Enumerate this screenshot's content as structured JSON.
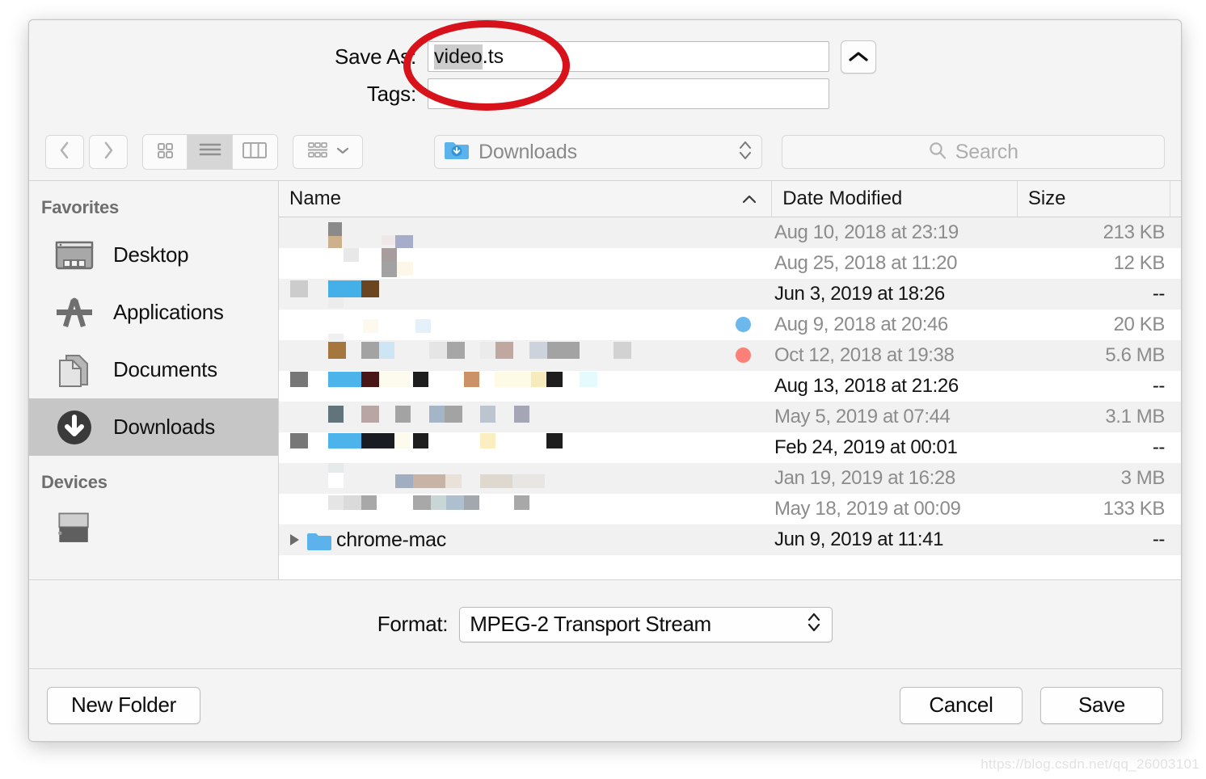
{
  "dialog": {
    "save_as_label": "Save As:",
    "save_as_value_selected": "video",
    "save_as_value_rest": ".ts",
    "tags_label": "Tags:",
    "tags_value": "",
    "tags_placeholder": ""
  },
  "toolbar": {
    "back_icon": "chevron-left-icon",
    "forward_icon": "chevron-right-icon",
    "view_icon_grid": "icon-view-icon",
    "view_icon_list": "list-view-icon",
    "view_icon_column": "column-view-icon",
    "arrange_icon": "arrange-by-icon",
    "current_folder": "Downloads",
    "search_placeholder": "Search"
  },
  "sidebar": {
    "sections": [
      {
        "title": "Favorites",
        "items": [
          {
            "label": "Desktop",
            "icon": "desktop-icon",
            "selected": false
          },
          {
            "label": "Applications",
            "icon": "applications-icon",
            "selected": false
          },
          {
            "label": "Documents",
            "icon": "documents-icon",
            "selected": false
          },
          {
            "label": "Downloads",
            "icon": "downloads-icon",
            "selected": true
          }
        ]
      },
      {
        "title": "Devices",
        "items": [
          {
            "label": "",
            "icon": "disk-drive-icon",
            "selected": false
          }
        ]
      }
    ]
  },
  "file_list": {
    "columns": [
      {
        "key": "name",
        "label": "Name",
        "sorted": true,
        "sort_dir": "asc"
      },
      {
        "key": "date",
        "label": "Date Modified"
      },
      {
        "key": "size",
        "label": "Size"
      }
    ],
    "rows": [
      {
        "name": "",
        "redacted": true,
        "date": "Aug 10, 2018 at 23:19",
        "size": "213 KB",
        "emphasis": "dim",
        "tag": ""
      },
      {
        "name": "",
        "redacted": true,
        "date": "Aug 25, 2018 at 11:20",
        "size": "12 KB",
        "emphasis": "dim",
        "tag": ""
      },
      {
        "name": "",
        "redacted": true,
        "date": "Jun 3, 2019 at 18:26",
        "size": "--",
        "emphasis": "dark",
        "tag": ""
      },
      {
        "name": "",
        "redacted": true,
        "date": "Aug 9, 2018 at 20:46",
        "size": "20 KB",
        "emphasis": "dim",
        "tag": "#6cb8ec"
      },
      {
        "name": "",
        "redacted": true,
        "date": "Oct 12, 2018 at 19:38",
        "size": "5.6 MB",
        "emphasis": "dim",
        "tag": "#fb8178"
      },
      {
        "name": "",
        "redacted": true,
        "date": "Aug 13, 2018 at 21:26",
        "size": "--",
        "emphasis": "dark",
        "tag": ""
      },
      {
        "name": "",
        "redacted": true,
        "date": "May 5, 2019 at 07:44",
        "size": "3.1 MB",
        "emphasis": "dim",
        "tag": ""
      },
      {
        "name": "",
        "redacted": true,
        "date": "Feb 24, 2019 at 00:01",
        "size": "--",
        "emphasis": "dark",
        "tag": ""
      },
      {
        "name": "",
        "redacted": true,
        "date": "Jan 19, 2019 at 16:28",
        "size": "3 MB",
        "emphasis": "dim",
        "tag": ""
      },
      {
        "name": "",
        "redacted": true,
        "date": "May 18, 2019 at 00:09",
        "size": "133 KB",
        "emphasis": "dim",
        "tag": ""
      },
      {
        "name": "chrome-mac",
        "redacted": false,
        "date": "Jun 9, 2019 at 11:41",
        "size": "--",
        "emphasis": "dark",
        "tag": ""
      }
    ]
  },
  "format": {
    "label": "Format:",
    "value": "MPEG-2 Transport Stream"
  },
  "footer": {
    "new_folder_label": "New Folder",
    "cancel_label": "Cancel",
    "save_label": "Save"
  },
  "annotation": {
    "shape": "ellipse",
    "color": "#d8121a",
    "target": "save-as-filename-field"
  },
  "watermark": {
    "text": "https://blog.csdn.net/qq_26003101"
  }
}
